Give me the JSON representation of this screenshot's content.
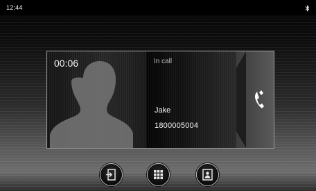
{
  "status_bar": {
    "time": "12:44",
    "bluetooth_icon": "bluetooth-icon"
  },
  "call": {
    "duration": "00:06",
    "status": "In call",
    "caller_name": "Jake",
    "caller_number": "1800005004",
    "avatar_icon": "person-silhouette-icon",
    "answer_icon": "phone-handset-icon"
  },
  "actions": [
    {
      "name": "transfer-button",
      "icon": "transfer-icon"
    },
    {
      "name": "keypad-button",
      "icon": "keypad-icon"
    },
    {
      "name": "contacts-button",
      "icon": "contacts-icon"
    }
  ],
  "colors": {
    "background_dark": "#050505",
    "background_light": "#6d6d6d",
    "text": "#f4f4f4",
    "muted_text": "#bdbdbd"
  }
}
